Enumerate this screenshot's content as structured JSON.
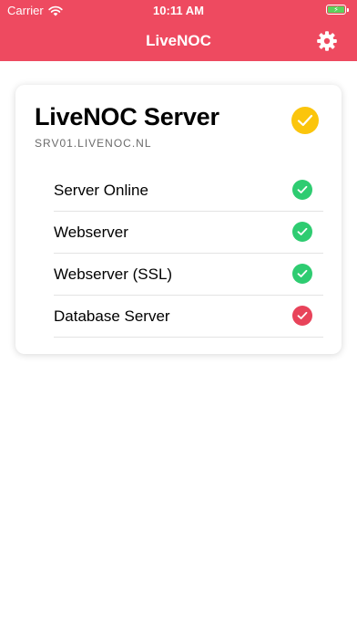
{
  "status_bar": {
    "carrier": "Carrier",
    "time": "10:11 AM",
    "battery_icon": "battery-charging-icon"
  },
  "header": {
    "title": "LiveNOC",
    "background_color": "#ee4a60",
    "settings_icon": "gear-icon"
  },
  "server_card": {
    "title": "LiveNOC Server",
    "hostname": "SRV01.LIVENOC.NL",
    "overall_status": "warning",
    "overall_status_color": "#fbc50c",
    "checks": [
      {
        "label": "Server Online",
        "status": "ok",
        "color": "#2ecc71"
      },
      {
        "label": "Webserver",
        "status": "ok",
        "color": "#2ecc71"
      },
      {
        "label": "Webserver (SSL)",
        "status": "ok",
        "color": "#2ecc71"
      },
      {
        "label": "Database Server",
        "status": "error",
        "color": "#e8435a"
      }
    ]
  }
}
